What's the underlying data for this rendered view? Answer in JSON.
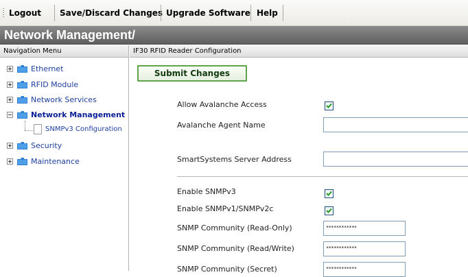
{
  "toolbar": {
    "logout": "Logout",
    "save_discard": "Save/Discard Changes",
    "upgrade": "Upgrade Software",
    "help": "Help"
  },
  "title": "Network Management/",
  "nav_header": "Navigation Menu",
  "main_header": "IF30 RFID Reader Configuration",
  "sidebar": {
    "items": [
      {
        "label": "Ethernet",
        "expanded": false
      },
      {
        "label": "RFID Module",
        "expanded": false
      },
      {
        "label": "Network Services",
        "expanded": false
      },
      {
        "label": "Network Management",
        "expanded": true,
        "active": true
      },
      {
        "label": "Security",
        "expanded": false
      },
      {
        "label": "Maintenance",
        "expanded": false
      }
    ],
    "sub_item": "SNMPv3 Configuration"
  },
  "main": {
    "submit_label": "Submit Changes",
    "fields": [
      {
        "label": "Allow Avalanche Access",
        "type": "checkbox",
        "checked": true
      },
      {
        "label": "Avalanche Agent Name",
        "type": "text",
        "value": ""
      },
      {
        "label": "SmartSystems Server Address",
        "type": "text",
        "value": ""
      },
      {
        "label": "Enable SNMPv3",
        "type": "checkbox",
        "checked": true
      },
      {
        "label": "Enable SNMPv1/SNMPv2c",
        "type": "checkbox",
        "checked": true
      },
      {
        "label": "SNMP Community (Read-Only)",
        "type": "password",
        "value": "************"
      },
      {
        "label": "SNMP Community (Read/Write)",
        "type": "password",
        "value": "************"
      },
      {
        "label": "SNMP Community (Secret)",
        "type": "password",
        "value": "************"
      }
    ]
  },
  "colors": {
    "titlebar": "#6e6e6e",
    "nav_link": "#1d3fa0",
    "submit_border": "#5fa34a",
    "checkmark": "#1e9a1e",
    "folder": "#2f7fd4"
  }
}
